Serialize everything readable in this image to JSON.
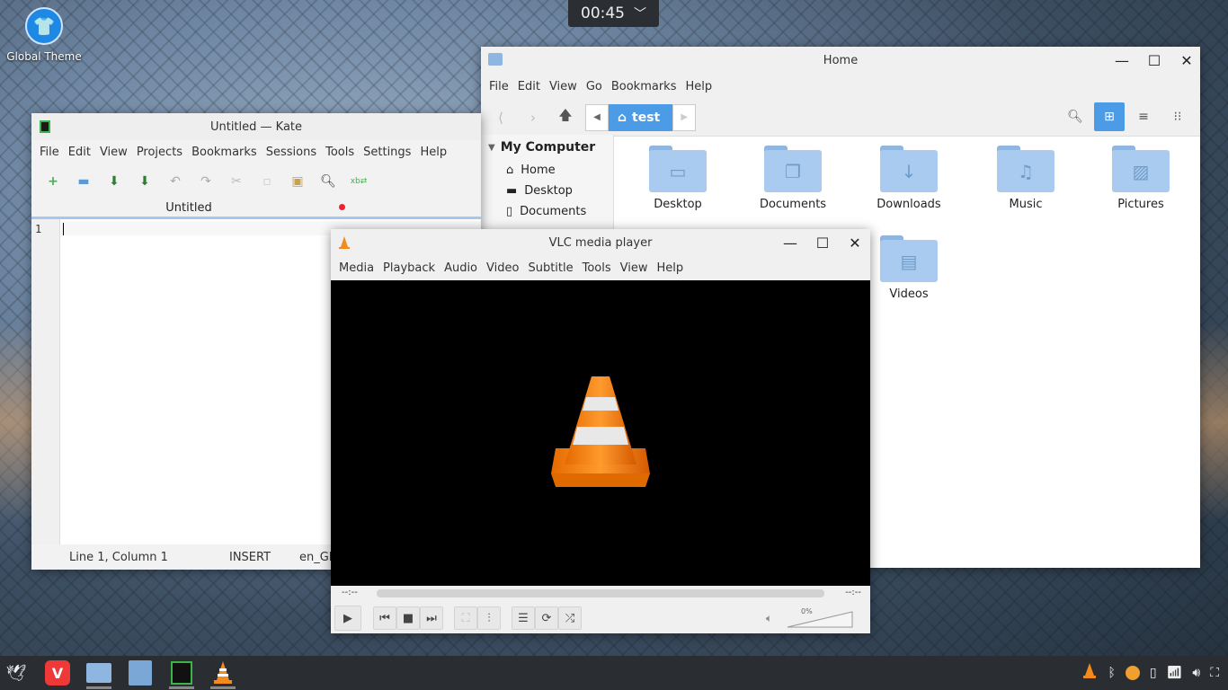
{
  "clock": {
    "time": "00:45",
    "chevron": "﹀"
  },
  "desktop": {
    "icon_label": "Global Theme",
    "icon_glyph": "👕"
  },
  "files": {
    "title": "Home",
    "menu": [
      "File",
      "Edit",
      "View",
      "Go",
      "Bookmarks",
      "Help"
    ],
    "breadcrumb": "test",
    "sidebar_heading": "My Computer",
    "sidebar_items": [
      "Home",
      "Desktop",
      "Documents"
    ],
    "folders": [
      {
        "label": "Desktop",
        "glyph": "▭"
      },
      {
        "label": "Documents",
        "glyph": "❐"
      },
      {
        "label": "Downloads",
        "glyph": "↓"
      },
      {
        "label": "Music",
        "glyph": "♫"
      },
      {
        "label": "Pictures",
        "glyph": "▨"
      },
      {
        "label": "Videos",
        "glyph": "▤"
      }
    ]
  },
  "kate": {
    "title": "Untitled — Kate",
    "menu": [
      "File",
      "Edit",
      "View",
      "Projects",
      "Bookmarks",
      "Sessions",
      "Tools",
      "Settings",
      "Help"
    ],
    "tab": "Untitled",
    "line_number": "1",
    "status": {
      "position": "Line 1, Column 1",
      "mode": "INSERT",
      "lang": "en_GB"
    }
  },
  "vlc": {
    "title": "VLC media player",
    "menu": [
      "Media",
      "Playback",
      "Audio",
      "Video",
      "Subtitle",
      "Tools",
      "View",
      "Help"
    ],
    "time_left": "--:--",
    "time_right": "--:--",
    "volume": "0%"
  },
  "colors": {
    "accent": "#4b9be6",
    "folder": "#a8cbef",
    "vlc_orange": "#f28a1e"
  }
}
